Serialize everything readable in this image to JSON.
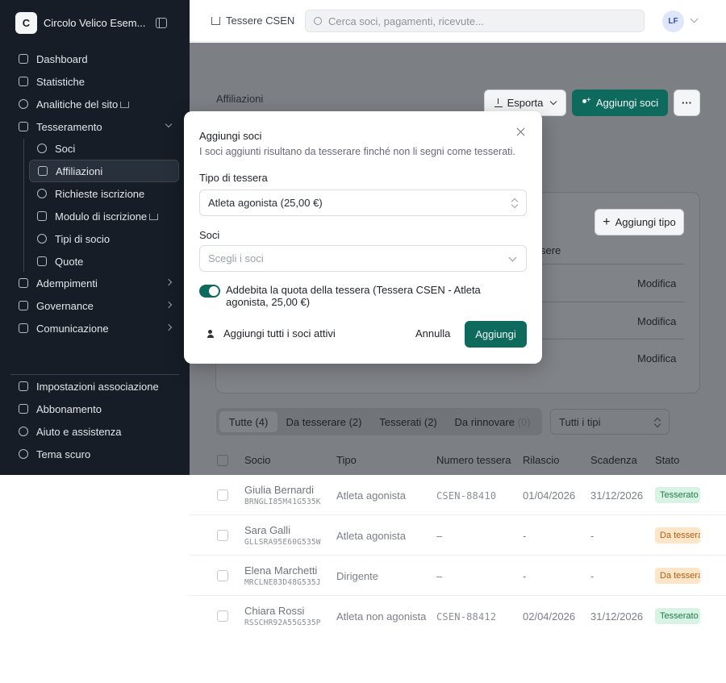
{
  "sidebar": {
    "brand_initial": "C",
    "brand_name": "Circolo Velico Esem...",
    "main_items": [
      {
        "label": "Dashboard",
        "icon": "home-icon"
      },
      {
        "label": "Statistiche",
        "icon": "chart-icon"
      },
      {
        "label": "Analitiche del sito",
        "icon": "analytics-icon"
      },
      {
        "label": "Tesseramento",
        "icon": "id-card-icon"
      }
    ],
    "sub_items": [
      {
        "label": "Soci",
        "icon": "users-icon"
      },
      {
        "label": "Affiliazioni",
        "icon": "building-icon"
      },
      {
        "label": "Richieste iscrizione",
        "icon": "user-plus-icon"
      },
      {
        "label": "Modulo di iscrizione",
        "icon": "form-icon"
      },
      {
        "label": "Tipi di socio",
        "icon": "users-icon"
      },
      {
        "label": "Quote",
        "icon": "tag-icon"
      }
    ],
    "section_items": [
      {
        "label": "Adempimenti",
        "icon": "document-icon"
      },
      {
        "label": "Governance",
        "icon": "scale-icon"
      },
      {
        "label": "Comunicazione",
        "icon": "megaphone-icon"
      }
    ],
    "bottom_items": [
      {
        "label": "Impostazioni associazione",
        "icon": "building-icon"
      },
      {
        "label": "Abbonamento",
        "icon": "crown-icon"
      },
      {
        "label": "Aiuto e assistenza",
        "icon": "help-icon"
      },
      {
        "label": "Tema scuro",
        "icon": "moon-icon"
      }
    ]
  },
  "topbar": {
    "breadcrumb": "Tessere CSEN",
    "search_placeholder": "Cerca soci, pagamenti, ricevute...",
    "avatar_initials": "LF"
  },
  "page": {
    "title": "Affiliazioni",
    "export_label": "Esporta",
    "add_members_label": "Aggiungi soci",
    "more_label": "···",
    "add_type_label": "Aggiungi tipo",
    "card_column_fragment": "sere",
    "edit_label": "Modifica"
  },
  "tabs": [
    {
      "label": "Tutte (4)"
    },
    {
      "label": "Da tesserare (2)"
    },
    {
      "label": "Tesserati (2)"
    },
    {
      "label": "Da rinnovare",
      "count": "(0)"
    }
  ],
  "filter": {
    "label": "Tutti i tipi"
  },
  "table": {
    "headers": [
      "Socio",
      "Tipo",
      "Numero tessera",
      "Rilascio",
      "Scadenza",
      "Stato"
    ],
    "rows": [
      {
        "name": "Giulia Bernardi",
        "code": "BRNGLI85M41G535K",
        "type": "Atleta agonista",
        "number": "CSEN-88410",
        "issued": "01/04/2026",
        "expiry": "31/12/2026",
        "status": "Tesserato",
        "status_kind": "ok"
      },
      {
        "name": "Sara Galli",
        "code": "GLLSRA95E60G535W",
        "type": "Atleta agonista",
        "number": "–",
        "issued": "-",
        "expiry": "-",
        "status": "Da tesserare",
        "status_kind": "todo"
      },
      {
        "name": "Elena Marchetti",
        "code": "MRCLNE83D48G535J",
        "type": "Dirigente",
        "number": "–",
        "issued": "-",
        "expiry": "-",
        "status": "Da tesserare",
        "status_kind": "todo"
      },
      {
        "name": "Chiara Rossi",
        "code": "RSSCHR92A55G535P",
        "type": "Atleta non agonista",
        "number": "CSEN-88412",
        "issued": "02/04/2026",
        "expiry": "31/12/2026",
        "status": "Tesserato",
        "status_kind": "ok"
      }
    ]
  },
  "modal": {
    "title": "Aggiungi soci",
    "description": "I soci aggiunti risultano da tesserare finché non li segni come tesserati.",
    "card_type_label": "Tipo di tessera",
    "card_type_value": "Atleta agonista (25,00 €)",
    "members_label": "Soci",
    "members_placeholder": "Scegli i soci",
    "charge_label": "Addebita la quota della tessera (Tessera CSEN - Atleta agonista, 25,00 €)",
    "charge_enabled": true,
    "add_all_label": "Aggiungi tutti i soci attivi",
    "cancel_label": "Annulla",
    "submit_label": "Aggiungi"
  },
  "colors": {
    "sidebar_bg": "#161d26",
    "primary": "#0e6a5d",
    "status_ok": "#1f7a4c",
    "status_todo": "#b25d14"
  }
}
